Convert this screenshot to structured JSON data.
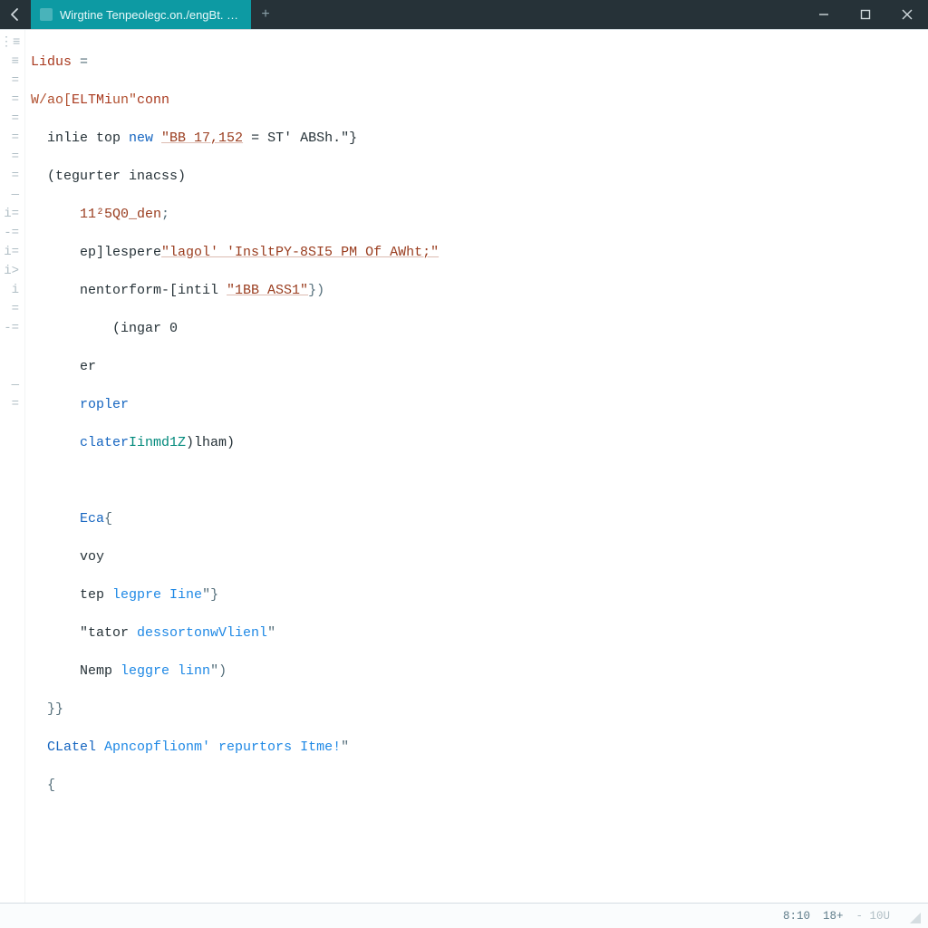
{
  "titlebar": {
    "tab_title": "Wirgtine Tenpeolegc.on./engBt. …",
    "new_tab_glyph": "+"
  },
  "gutter": [
    "⋮≡",
    "≡",
    "=",
    "=",
    "=",
    "=",
    "=",
    "=",
    "—",
    "i=",
    "-=",
    "i=",
    "i>",
    "i",
    "=",
    "-=",
    "",
    "",
    "—",
    "=",
    ""
  ],
  "code": {
    "l0": {
      "a": "Lidus",
      "b": " ="
    },
    "l1": {
      "a": "W/ao[",
      "b": "ELTMi",
      "c": "un\"",
      "d": "conn"
    },
    "l2": {
      "a": "inlie top ",
      "b": "new ",
      "c": "\"BB 17,152",
      "d": " = ST' ABSh.\"}"
    },
    "l3": {
      "a": "(tegurter inacss)"
    },
    "l4": {
      "a": "11²5Q0_den",
      "b": ";"
    },
    "l5": {
      "a": "ep]lespere",
      "b": "\"lagol' 'InsltPY-8SI5 PM Of AWht;\""
    },
    "l6": {
      "a": "nentorform-[intil ",
      "b": "\"1BB ASS1\"",
      "c": "})"
    },
    "l7": {
      "a": "(ingar 0"
    },
    "l8": {
      "a": "er"
    },
    "l9": {
      "a": "ropler"
    },
    "l10": {
      "a": "clater",
      "b": "Iinmd1Z",
      ")c": ")lham)"
    },
    "l11": {
      "a": ""
    },
    "l12": {
      "a": "Eca",
      "b": "{"
    },
    "l13": {
      "a": "voy"
    },
    "l14": {
      "a": "tep ",
      "b": "legpre Iine",
      "c": "\"}"
    },
    "l15": {
      "a": "\"tator ",
      "b": "dessortonwVlienl",
      "c": "\""
    },
    "l16": {
      "a": "Nemp ",
      "b": "leggre linn",
      "c": "\")"
    },
    "l17": {
      "a": "}}"
    },
    "l18": {
      "a": "CLatel ",
      "b": "Apncopflionm' repurtors Itme!",
      "c": "\""
    },
    "l19": {
      "a": "{"
    }
  },
  "status": {
    "left": "8:10",
    "mid": "18+",
    "right": "- 10U"
  }
}
